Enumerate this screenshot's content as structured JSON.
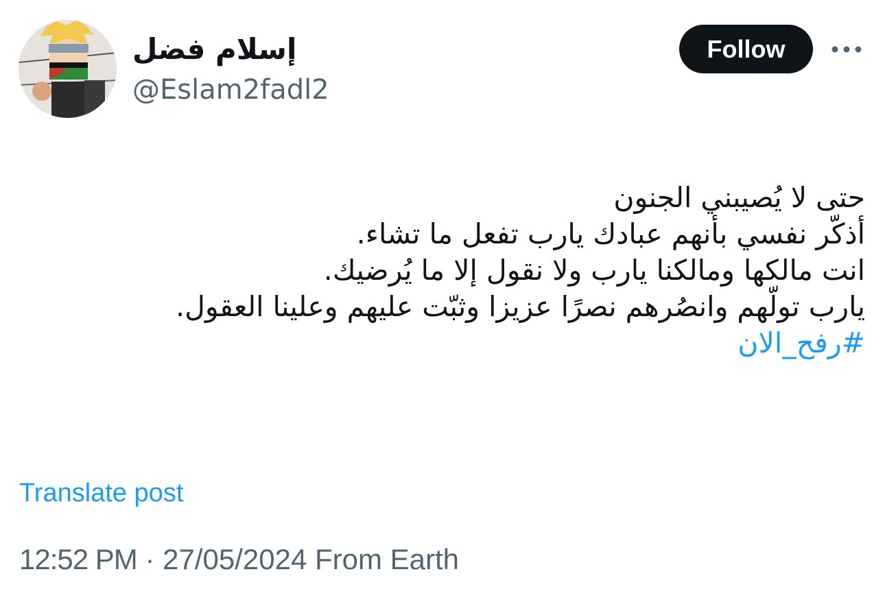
{
  "author": {
    "display_name": "إسلام فضل",
    "handle": "@Eslam2fadl2"
  },
  "header": {
    "follow_label": "Follow",
    "more_icon": "more-horizontal-icon"
  },
  "tweet": {
    "lines": [
      "حتى لا يُصيبني الجنون",
      "أذكّر نفسي بأنهم عبادك يارب تفعل ما تشاء.",
      "انت مالكها ومالكنا يارب ولا نقول إلا ما يُرضيك.",
      "يارب تولّهم وانصُرهم نصرًا عزيزا وثبّت عليهم وعلينا العقول."
    ],
    "hashtag": "#رفح_الان"
  },
  "translate_label": "Translate post",
  "meta": {
    "time": "12:52 PM",
    "separator": " · ",
    "date": "27/05/2024",
    "source": " From Earth"
  },
  "colors": {
    "accent": "#1d9bf0",
    "secondary_text": "#536471",
    "primary_text": "#0f1419",
    "button_bg": "#0f1419"
  }
}
